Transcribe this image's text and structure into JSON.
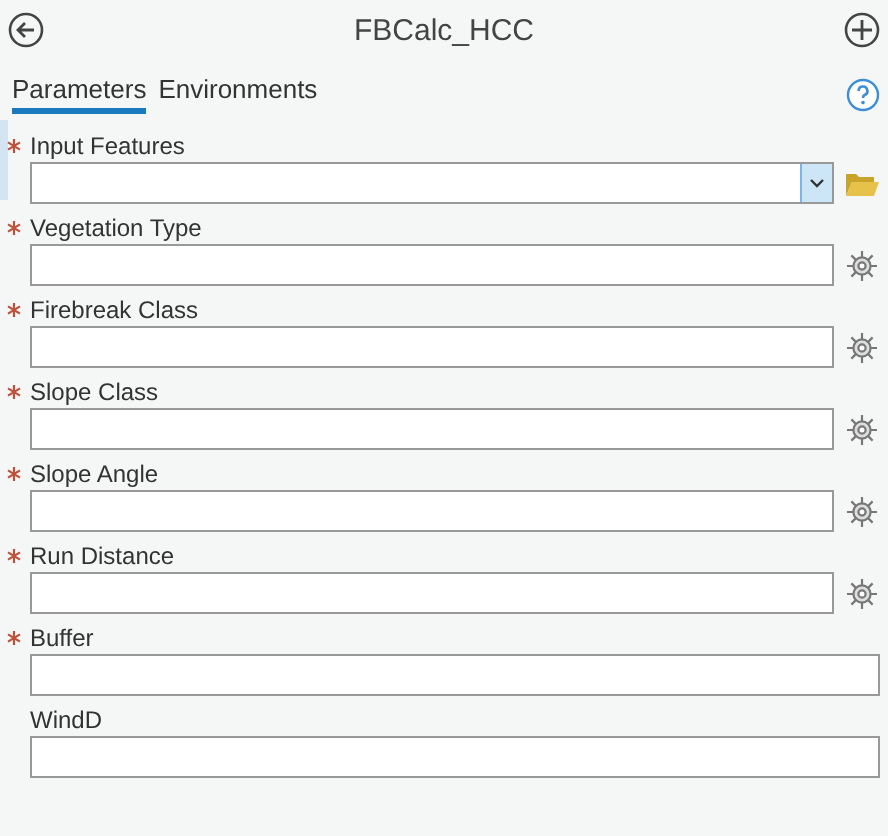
{
  "header": {
    "title": "FBCalc_HCC"
  },
  "tabs": [
    {
      "label": "Parameters",
      "selected": true
    },
    {
      "label": "Environments",
      "selected": false
    }
  ],
  "parameters": [
    {
      "kind": "dropdown",
      "label": "Input Features",
      "required": true,
      "selected": true
    },
    {
      "kind": "gear",
      "label": "Vegetation Type",
      "required": true,
      "selected": false
    },
    {
      "kind": "gear",
      "label": "Firebreak Class",
      "required": true,
      "selected": false
    },
    {
      "kind": "gear",
      "label": "Slope Class",
      "required": true,
      "selected": false
    },
    {
      "kind": "gear",
      "label": "Slope Angle",
      "required": true,
      "selected": false
    },
    {
      "kind": "gear",
      "label": "Run Distance",
      "required": true,
      "selected": false
    },
    {
      "kind": "plain",
      "label": "Buffer",
      "required": true,
      "selected": false
    },
    {
      "kind": "plain",
      "label": "WindD",
      "required": false,
      "selected": false
    }
  ]
}
